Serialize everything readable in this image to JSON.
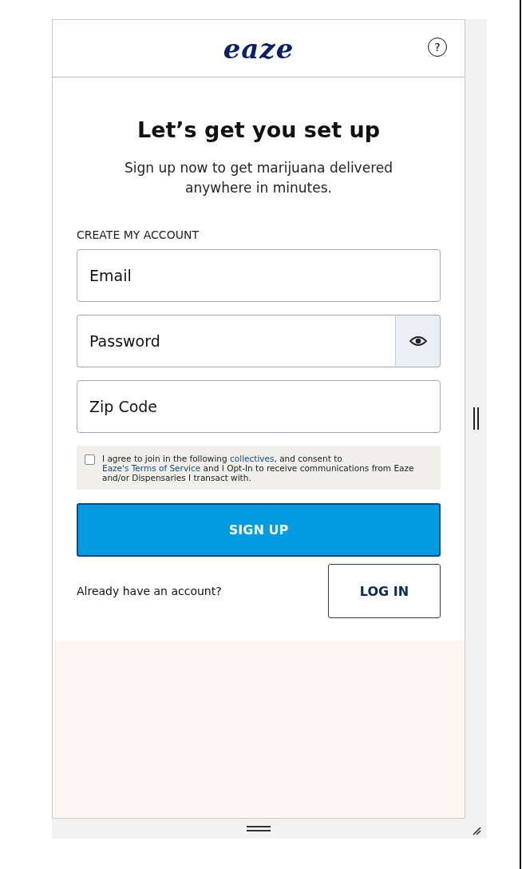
{
  "header": {
    "logo": "eaze",
    "help": "?"
  },
  "title": "Let’s get you set up",
  "subtitle": "Sign up now to get marijuana delivered anywhere in minutes.",
  "section_label": "CREATE MY ACCOUNT",
  "fields": [
    {
      "placeholder": "Email",
      "kind": "text"
    },
    {
      "placeholder": "Password",
      "kind": "password"
    },
    {
      "placeholder": "Zip Code",
      "kind": "text"
    }
  ],
  "consent": {
    "checked": false,
    "segments": [
      {
        "kind": "text",
        "text": "I agree to join in the following "
      },
      {
        "kind": "link",
        "text": "collectives"
      },
      {
        "kind": "text",
        "text": ", and consent to "
      },
      {
        "kind": "link",
        "text": "Eaze's Terms of Service"
      },
      {
        "kind": "text",
        "text": " and I Opt-In to receive communications from Eaze and/or Dispensaries I transact with."
      }
    ]
  },
  "signup_button": "SIGN UP",
  "login_prompt": "Already have an account?",
  "login_button": "LOG IN"
}
